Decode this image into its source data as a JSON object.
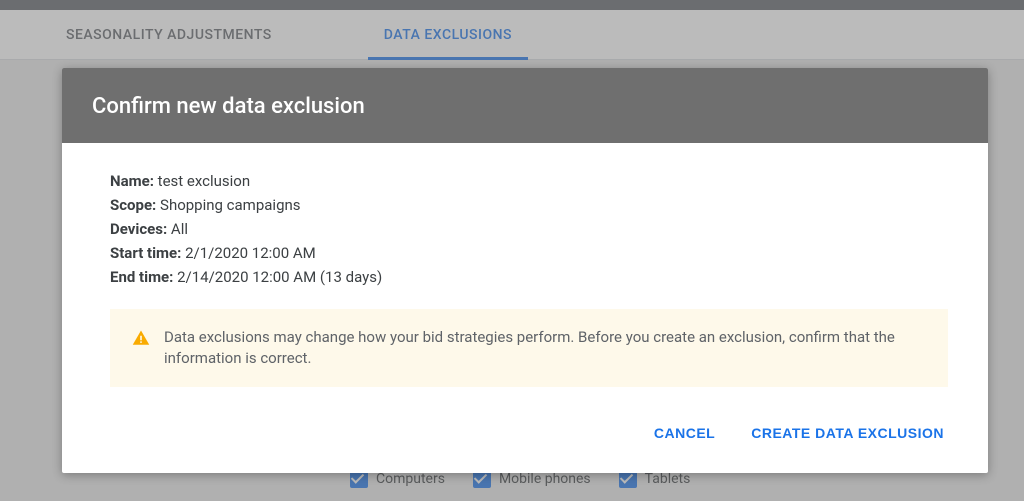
{
  "tabs": {
    "seasonality": "SEASONALITY ADJUSTMENTS",
    "data_exclusions": "DATA EXCLUSIONS"
  },
  "bg_devices": {
    "computers": "Computers",
    "mobile": "Mobile phones",
    "tablets": "Tablets"
  },
  "dialog": {
    "title": "Confirm new data exclusion",
    "labels": {
      "name": "Name:",
      "scope": "Scope:",
      "devices": "Devices:",
      "start": "Start time:",
      "end": "End time:"
    },
    "values": {
      "name": "test exclusion",
      "scope": "Shopping campaigns",
      "devices": "All",
      "start": "2/1/2020 12:00 AM",
      "end": "2/14/2020 12:00 AM (13 days)"
    },
    "warning": "Data exclusions may change how your bid strategies perform. Before you create an exclusion, confirm that the information is correct.",
    "actions": {
      "cancel": "CANCEL",
      "confirm": "CREATE DATA EXCLUSION"
    }
  }
}
